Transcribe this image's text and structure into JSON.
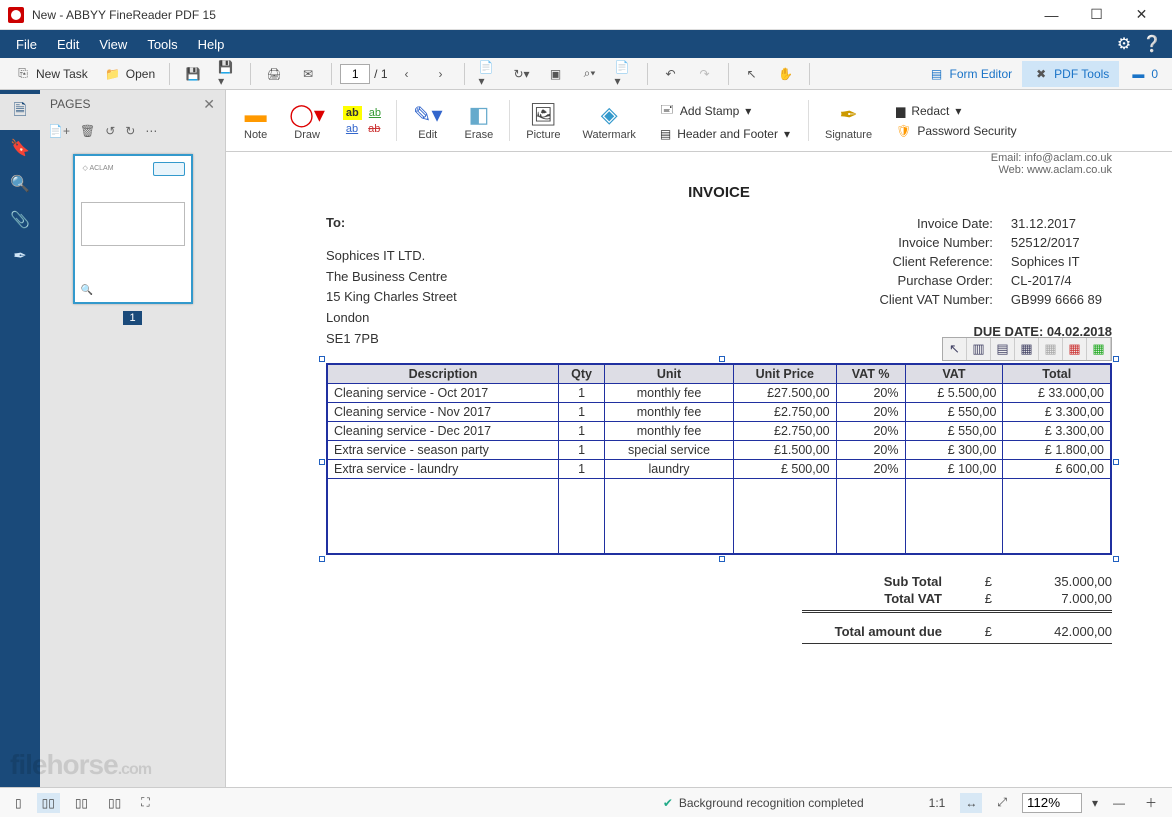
{
  "window": {
    "title": "New - ABBYY FineReader PDF 15"
  },
  "menu": {
    "items": [
      "File",
      "Edit",
      "View",
      "Tools",
      "Help"
    ]
  },
  "toolbar": {
    "new_task": "New Task",
    "open": "Open",
    "page_current": "1",
    "page_total": "/ 1",
    "form_editor": "Form Editor",
    "pdf_tools": "PDF Tools",
    "compare_count": "0"
  },
  "pages_panel": {
    "title": "PAGES",
    "thumb_number": "1"
  },
  "ribbon": {
    "note": "Note",
    "draw": "Draw",
    "edit": "Edit",
    "erase": "Erase",
    "picture": "Picture",
    "watermark": "Watermark",
    "add_stamp": "Add Stamp",
    "header_footer": "Header and Footer",
    "signature": "Signature",
    "redact": "Redact",
    "password": "Password Security"
  },
  "document": {
    "email": "Email: info@aclam.co.uk",
    "web": "Web: www.aclam.co.uk",
    "invoice_heading": "INVOICE",
    "to_label": "To:",
    "to_lines": [
      "Sophices IT LTD.",
      "The Business Centre",
      "15 King Charles Street",
      "London",
      "SE1 7PB"
    ],
    "meta": [
      [
        "Invoice Date:",
        "31.12.2017"
      ],
      [
        "Invoice Number:",
        "52512/2017"
      ],
      [
        "Client Reference:",
        "Sophices IT"
      ],
      [
        "Purchase Order:",
        "CL-2017/4"
      ],
      [
        "Client VAT Number:",
        "GB999 6666 89"
      ]
    ],
    "due_date": "DUE DATE: 04.02.2018",
    "table": {
      "headers": [
        "Description",
        "Qty",
        "Unit",
        "Unit Price",
        "VAT %",
        "VAT",
        "Total"
      ],
      "rows": [
        [
          "Cleaning service - Oct 2017",
          "1",
          "monthly fee",
          "£27.500,00",
          "20%",
          "£  5.500,00",
          "£     33.000,00"
        ],
        [
          "Cleaning service - Nov 2017",
          "1",
          "monthly fee",
          "£2.750,00",
          "20%",
          "£     550,00",
          "£       3.300,00"
        ],
        [
          "Cleaning service - Dec 2017",
          "1",
          "monthly fee",
          "£2.750,00",
          "20%",
          "£     550,00",
          "£       3.300,00"
        ],
        [
          "Extra service - season party",
          "1",
          "special service",
          "£1.500,00",
          "20%",
          "£     300,00",
          "£       1.800,00"
        ],
        [
          "Extra service - laundry",
          "1",
          "laundry",
          "£     500,00",
          "20%",
          "£     100,00",
          "£          600,00"
        ]
      ]
    },
    "totals": {
      "sub": [
        "Sub Total",
        "£",
        "35.000,00"
      ],
      "vat": [
        "Total VAT",
        "£",
        "7.000,00"
      ],
      "due": [
        "Total amount due",
        "£",
        "42.000,00"
      ]
    }
  },
  "status": {
    "recognition": "Background recognition completed",
    "ratio": "1:1",
    "zoom": "112%"
  },
  "watermark": {
    "brand": "filehorse",
    "tld": ".com"
  }
}
